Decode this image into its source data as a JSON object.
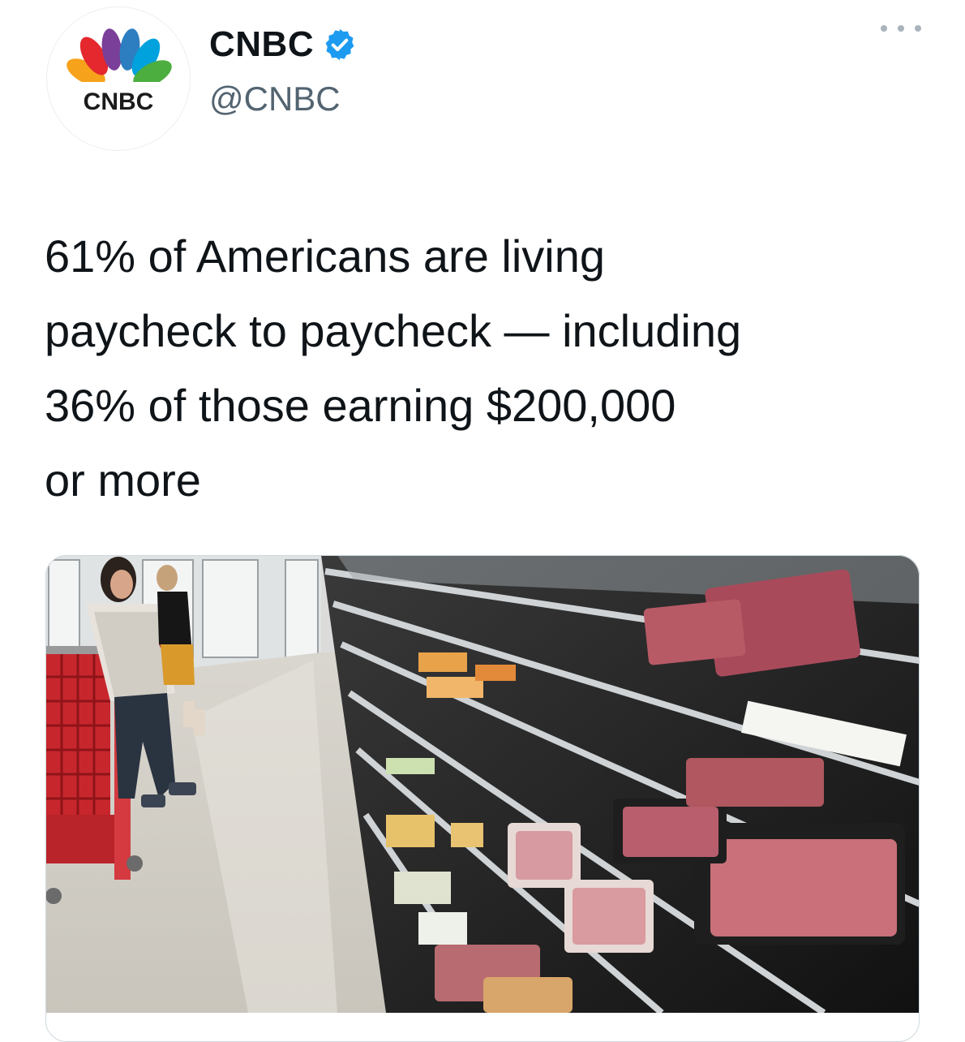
{
  "author": {
    "logo_text": "CNBC",
    "display_name": "CNBC",
    "handle": "@CNBC",
    "verified_icon": "verified-badge-icon"
  },
  "tweet": {
    "text": "61% of Americans are living\npaycheck to paycheck — including\n36% of those earning $200,000\nor more"
  },
  "media": {
    "description_icon": "supermarket-photo"
  },
  "colors": {
    "verified_blue": "#1d9bf0",
    "handle_gray": "#536471",
    "border": "#cfd9de",
    "cart_red": "#c8262d"
  }
}
